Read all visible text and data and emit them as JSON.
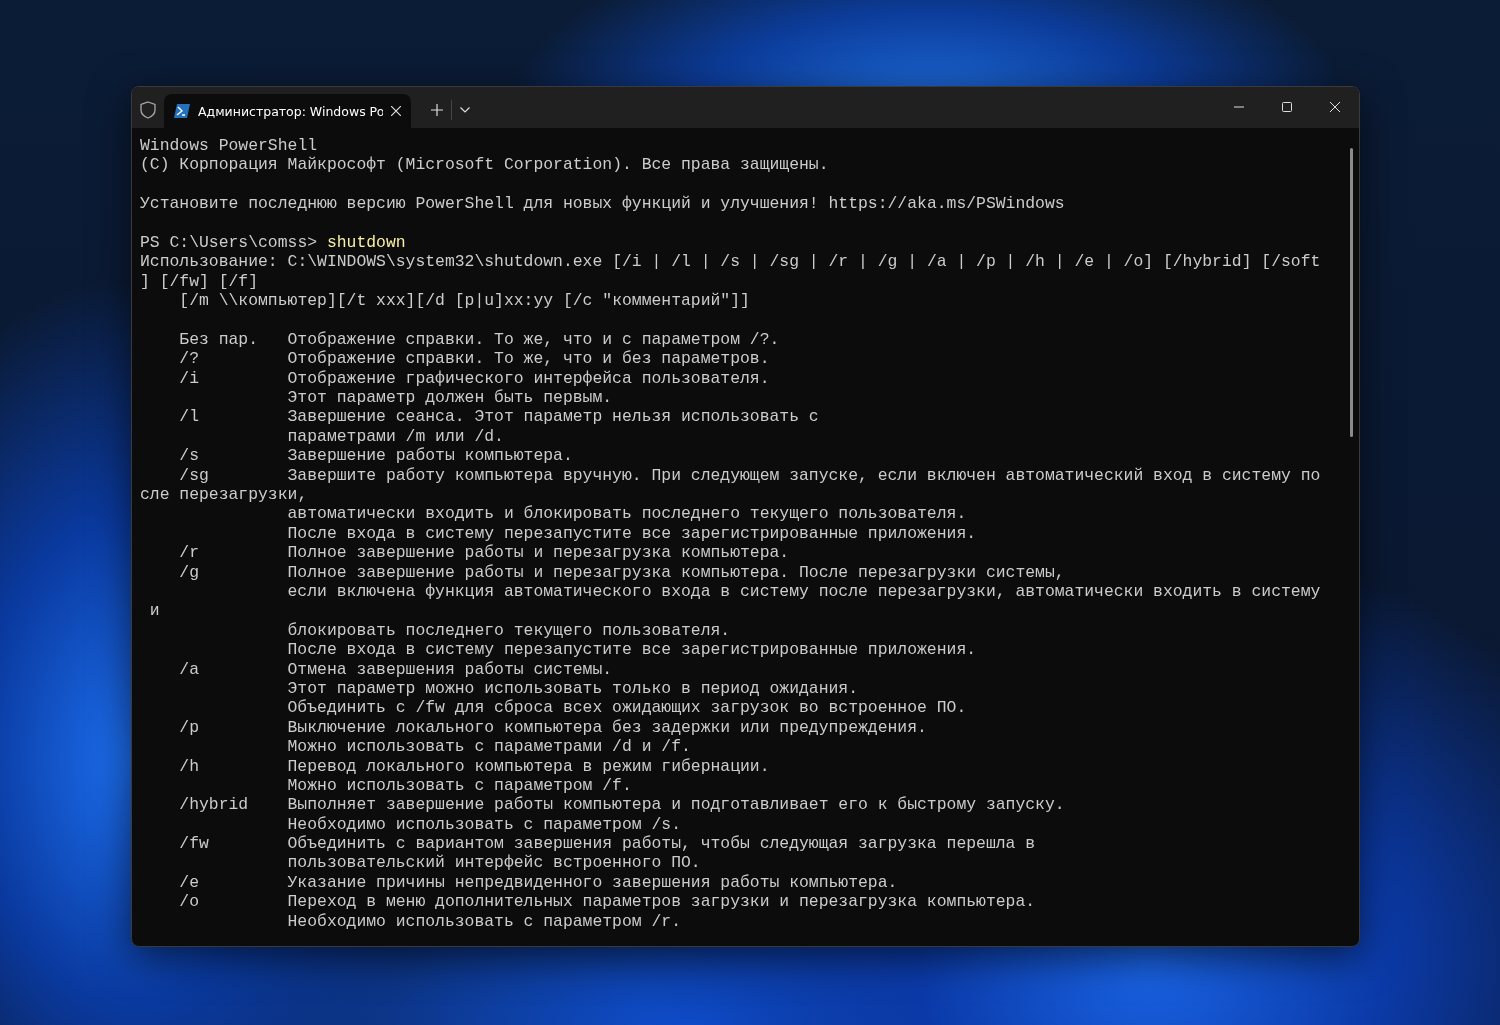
{
  "window": {
    "tabs": [
      {
        "title": "Администратор: Windows Po",
        "selected": true
      }
    ]
  },
  "terminal": {
    "lines": [
      {
        "kind": "text",
        "text": "Windows PowerShell"
      },
      {
        "kind": "text",
        "text": "(C) Корпорация Майкрософт (Microsoft Corporation). Все права защищены."
      },
      {
        "kind": "blank"
      },
      {
        "kind": "text",
        "text": "Установите последнюю версию PowerShell для новых функций и улучшения! https://aka.ms/PSWindows"
      },
      {
        "kind": "blank"
      },
      {
        "kind": "command",
        "prompt": "PS C:\\Users\\comss>",
        "command": "shutdown"
      },
      {
        "kind": "text",
        "text": "Использование: C:\\WINDOWS\\system32\\shutdown.exe [/i | /l | /s | /sg | /r | /g | /a | /p | /h | /e | /o] [/hybrid] [/soft"
      },
      {
        "kind": "text",
        "text": "] [/fw] [/f]"
      },
      {
        "kind": "indented",
        "text": "[/m \\\\компьютер][/t xxx][/d [p|u]xx:yy [/c \"комментарий\"]]"
      },
      {
        "kind": "blank"
      },
      {
        "kind": "option",
        "option": "Без пар.",
        "text": "Отображение справки. То же, что и с параметром /?."
      },
      {
        "kind": "option",
        "option": "/?",
        "text": "Отображение справки. То же, что и без параметров."
      },
      {
        "kind": "option",
        "option": "/i",
        "text": "Отображение графического интерфейса пользователя."
      },
      {
        "kind": "option",
        "text": "Этот параметр должен быть первым."
      },
      {
        "kind": "option",
        "option": "/l",
        "text": "Завершение сеанса. Этот параметр нельзя использовать с"
      },
      {
        "kind": "option",
        "text": "параметрами /m или /d."
      },
      {
        "kind": "option",
        "option": "/s",
        "text": "Завершение работы компьютера."
      },
      {
        "kind": "option",
        "option": "/sg",
        "text": "Завершите работу компьютера вручную. При следующем запуске, если включен автоматический вход в систему по"
      },
      {
        "kind": "text",
        "text": "сле перезагрузки,"
      },
      {
        "kind": "option",
        "text": "автоматически входить и блокировать последнего текущего пользователя."
      },
      {
        "kind": "option",
        "text": "После входа в систему перезапустите все зарегистрированные приложения."
      },
      {
        "kind": "option",
        "option": "/r",
        "text": "Полное завершение работы и перезагрузка компьютера."
      },
      {
        "kind": "option",
        "option": "/g",
        "text": "Полное завершение работы и перезагрузка компьютера. После перезагрузки системы,"
      },
      {
        "kind": "option",
        "text": "если включена функция автоматического входа в систему после перезагрузки, автоматически входить в систему"
      },
      {
        "kind": "wrap",
        "text": "и"
      },
      {
        "kind": "option",
        "text": "блокировать последнего текущего пользователя."
      },
      {
        "kind": "option",
        "text": "После входа в систему перезапустите все зарегистрированные приложения."
      },
      {
        "kind": "option",
        "option": "/a",
        "text": "Отмена завершения работы системы."
      },
      {
        "kind": "option",
        "text": "Этот параметр можно использовать только в период ожидания."
      },
      {
        "kind": "option",
        "text": "Объединить с /fw для сброса всех ожидающих загрузок во встроенное ПО."
      },
      {
        "kind": "option",
        "option": "/p",
        "text": "Выключение локального компьютера без задержки или предупреждения."
      },
      {
        "kind": "option",
        "text": "Можно использовать с параметрами /d и /f."
      },
      {
        "kind": "option",
        "option": "/h",
        "text": "Перевод локального компьютера в режим гибернации."
      },
      {
        "kind": "option",
        "text": "Можно использовать с параметром /f."
      },
      {
        "kind": "option",
        "option": "/hybrid",
        "text": "Выполняет завершение работы компьютера и подготавливает его к быстрому запуску."
      },
      {
        "kind": "option",
        "text": "Необходимо использовать с параметром /s."
      },
      {
        "kind": "option",
        "option": "/fw",
        "text": "Объединить с вариантом завершения работы, чтобы следующая загрузка перешла в"
      },
      {
        "kind": "option",
        "text": "пользовательский интерфейс встроенного ПО."
      },
      {
        "kind": "option",
        "option": "/e",
        "text": "Указание причины непредвиденного завершения работы компьютера."
      },
      {
        "kind": "option",
        "option": "/o",
        "text": "Переход в меню дополнительных параметров загрузки и перезагрузка компьютера."
      },
      {
        "kind": "option",
        "text": "Необходимо использовать с параметром /r."
      }
    ]
  }
}
